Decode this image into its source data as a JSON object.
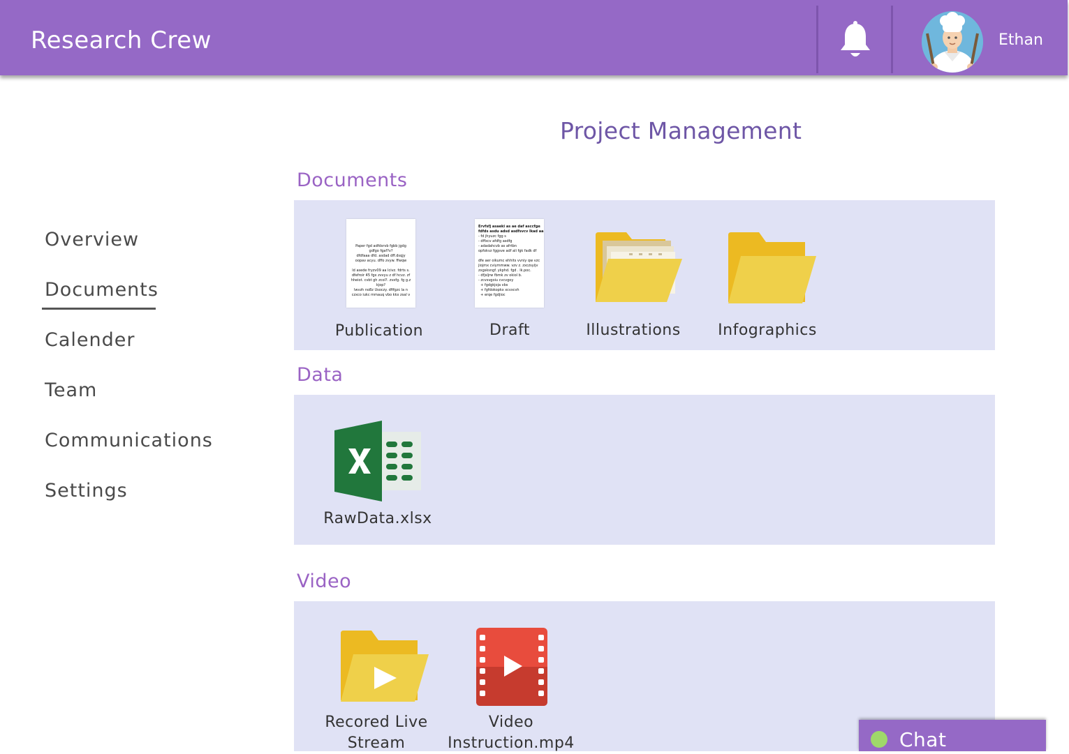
{
  "header": {
    "app_title": "Research Crew",
    "username": "Ethan",
    "bell_icon": "bell-icon",
    "avatar_icon": "chef-avatar"
  },
  "page": {
    "title": "Project Management"
  },
  "sidebar": {
    "items": [
      {
        "label": "Overview"
      },
      {
        "label": "Documents",
        "active": true
      },
      {
        "label": "Calender"
      },
      {
        "label": "Team"
      },
      {
        "label": "Communications"
      },
      {
        "label": "Settings"
      }
    ]
  },
  "sections": {
    "documents": {
      "label": "Documents",
      "items": [
        {
          "label": "Publication",
          "icon": "document-thumbnail-icon"
        },
        {
          "label": "Draft",
          "icon": "document-thumbnail-icon"
        },
        {
          "label": "Illustrations",
          "icon": "folder-with-papers-icon"
        },
        {
          "label": "Infographics",
          "icon": "folder-icon"
        }
      ]
    },
    "data": {
      "label": "Data",
      "items": [
        {
          "label": "RawData.xlsx",
          "icon": "excel-icon"
        }
      ]
    },
    "video": {
      "label": "Video",
      "items": [
        {
          "label_line1": "Recored Live",
          "label_line2": "Stream",
          "icon": "video-folder-icon"
        },
        {
          "label_line1": "Video",
          "label_line2": "Instruction.mp4",
          "icon": "video-file-icon"
        }
      ]
    }
  },
  "chat": {
    "label": "Chat",
    "status": "online"
  },
  "colors": {
    "header_bg": "#9569c6",
    "panel_bg": "#e0e2f5",
    "section_label": "#9a63c4",
    "page_title": "#6e56a6",
    "folder": "#efd04a",
    "excel": "#21773c",
    "video": "#e84c3d",
    "online": "#9fd96a"
  }
}
